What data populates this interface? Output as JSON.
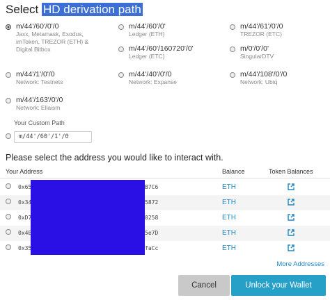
{
  "title": {
    "prefix": "Select ",
    "highlight": "HD derivation path"
  },
  "paths": [
    {
      "path": "m/44'/60'/0'/0",
      "desc": "Jaxx, Metamask, Exodus,\nimToken, TREZOR (ETH) &\nDigital Bitbox",
      "checked": true
    },
    {
      "path": "m/44'/60'/0'",
      "desc": "Ledger (ETH)",
      "checked": false
    },
    {
      "path": "m/44'/61'/0'/0",
      "desc": "TREZOR (ETC)",
      "checked": false
    },
    {
      "path": "m/44'/60'/160720'/0'",
      "desc": "Ledger (ETC)",
      "checked": false
    },
    {
      "path": "m/0'/0'/0'",
      "desc": "SingularDTV",
      "checked": false
    },
    {
      "path": "m/44'/1'/0'/0",
      "desc": "Network: Testnets",
      "checked": false
    },
    {
      "path": "m/44'/40'/0'/0",
      "desc": "Network: Expanse",
      "checked": false
    },
    {
      "path": "m/44'/108'/0'/0",
      "desc": "Network: Ubiq",
      "checked": false
    },
    {
      "path": "m/44'/163'/0'/0",
      "desc": "Network: Ellaism",
      "checked": false
    }
  ],
  "custom": {
    "label": "Your Custom Path",
    "value": "m/44'/60'/1'/0"
  },
  "prompt": "Please select the address you would like to interact with.",
  "table": {
    "headers": {
      "address": "Your Address",
      "balance": "Balance",
      "tokens": "Token Balances"
    },
    "rows": [
      {
        "start": "0x65",
        "end": "B7C6",
        "balance": "ETH"
      },
      {
        "start": "0x34",
        "end": "5872",
        "balance": "ETH"
      },
      {
        "start": "0xD7",
        "end": "0258",
        "balance": "ETH"
      },
      {
        "start": "0x4E",
        "end": "5e7D",
        "balance": "ETH"
      },
      {
        "start": "0x35",
        "end": "faCc",
        "balance": "ETH"
      }
    ]
  },
  "more_addresses": "More Addresses",
  "buttons": {
    "cancel": "Cancel",
    "unlock": "Unlock your Wallet"
  },
  "colors": {
    "accent": "#1e88c7",
    "unlock_bg": "#27a0c8",
    "redaction": "#2b10e6",
    "highlight": "#3b6fd6"
  }
}
